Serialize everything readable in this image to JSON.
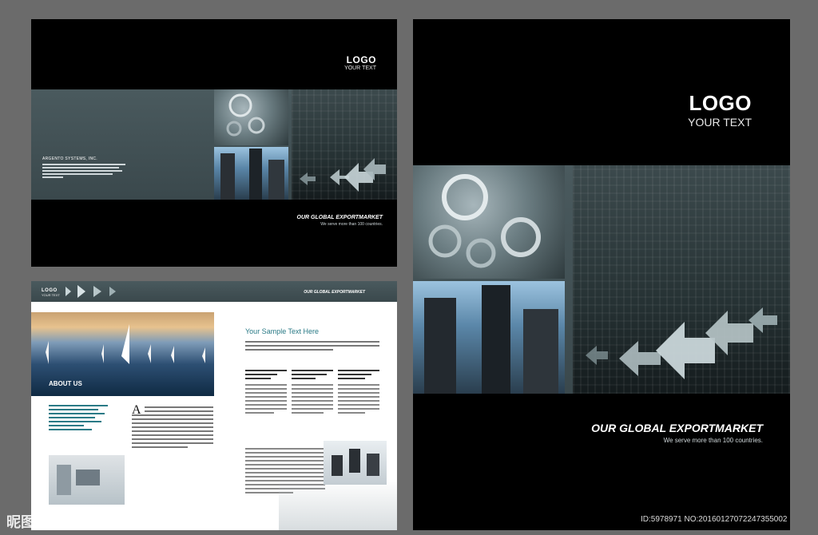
{
  "cover_small": {
    "logo": "LOGO",
    "tagline": "YOUR TEXT",
    "company": "ARGENTO SYSTEMS, INC.",
    "heading": "OUR GLOBAL EXPORTMARKET",
    "subheading": "We serve more than 100 countries."
  },
  "cover_large": {
    "logo": "LOGO",
    "tagline": "YOUR TEXT",
    "heading": "OUR GLOBAL EXPORTMARKET",
    "subheading": "We serve more than 100 countries."
  },
  "inner_spread": {
    "logo": "LOGO",
    "tagline": "YOUR TEXT",
    "header_right": "OUR GLOBAL EXPORTMARKET",
    "about_title": "ABOUT US",
    "sample_title": "Your Sample Text Here",
    "drop_cap": "A"
  },
  "watermark": {
    "site": "昵图网 www.nipic.com",
    "id": "ID:5978971 NO:20160127072247355002"
  },
  "colors": {
    "page_bg": "#6b6b6b",
    "black": "#000000",
    "steel": "#4a5a5e",
    "teal_text": "#2a7a86"
  }
}
